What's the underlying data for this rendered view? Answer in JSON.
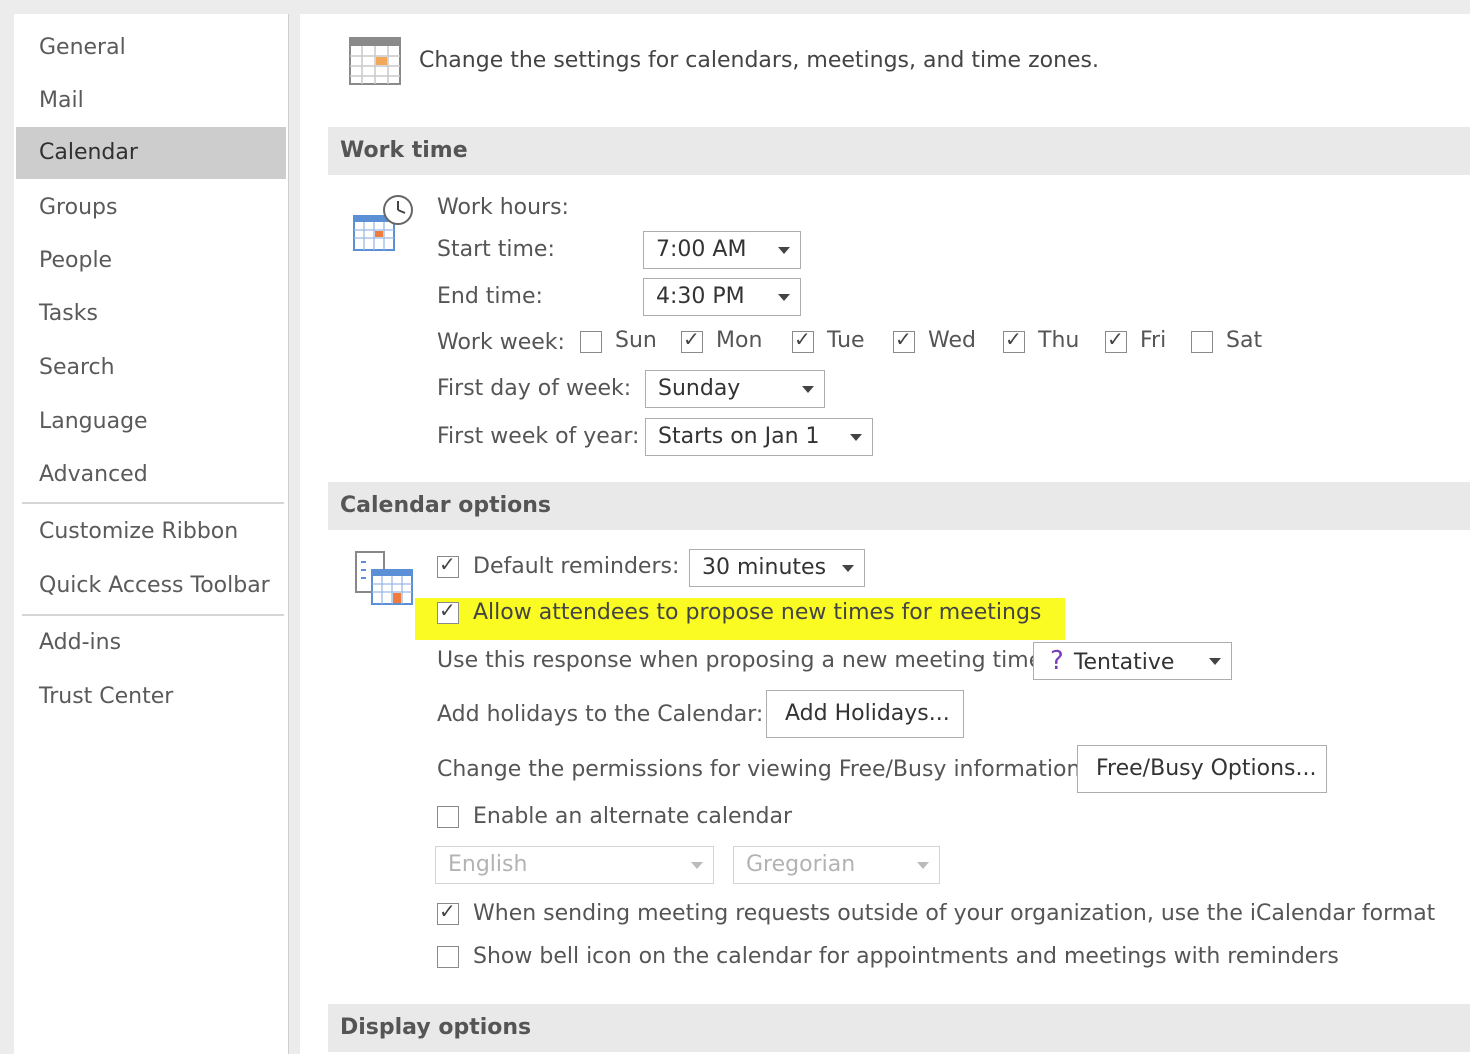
{
  "sidebar": {
    "items": [
      {
        "label": "General"
      },
      {
        "label": "Mail"
      },
      {
        "label": "Calendar"
      },
      {
        "label": "Groups"
      },
      {
        "label": "People"
      },
      {
        "label": "Tasks"
      },
      {
        "label": "Search"
      },
      {
        "label": "Language"
      },
      {
        "label": "Advanced"
      },
      {
        "label": "Customize Ribbon"
      },
      {
        "label": "Quick Access Toolbar"
      },
      {
        "label": "Add-ins"
      },
      {
        "label": "Trust Center"
      }
    ],
    "selected": "Calendar"
  },
  "header": {
    "description": "Change the settings for calendars, meetings, and time zones."
  },
  "work_time": {
    "title": "Work time",
    "work_hours_label": "Work hours:",
    "start_time_label": "Start time:",
    "start_time_value": "7:00 AM",
    "end_time_label": "End time:",
    "end_time_value": "4:30 PM",
    "work_week_label": "Work week:",
    "days": [
      {
        "label": "Sun",
        "checked": false
      },
      {
        "label": "Mon",
        "checked": true
      },
      {
        "label": "Tue",
        "checked": true
      },
      {
        "label": "Wed",
        "checked": true
      },
      {
        "label": "Thu",
        "checked": true
      },
      {
        "label": "Fri",
        "checked": true
      },
      {
        "label": "Sat",
        "checked": false
      }
    ],
    "first_day_label": "First day of week:",
    "first_day_value": "Sunday",
    "first_week_label": "First week of year:",
    "first_week_value": "Starts on Jan 1"
  },
  "calendar_options": {
    "title": "Calendar options",
    "default_reminders_label": "Default reminders:",
    "default_reminders_checked": true,
    "default_reminders_value": "30 minutes",
    "allow_propose_label": "Allow attendees to propose new times for meetings",
    "allow_propose_checked": true,
    "response_label": "Use this response when proposing a new meeting time:",
    "response_value": "Tentative",
    "response_glyph": "?",
    "holidays_label": "Add holidays to the Calendar:",
    "holidays_button": "Add Holidays...",
    "permissions_label": "Change the permissions for viewing Free/Busy information:",
    "freebusy_button": "Free/Busy Options...",
    "alternate_label": "Enable an alternate calendar",
    "alternate_checked": false,
    "alt_language_value": "English",
    "alt_calendar_value": "Gregorian",
    "icalendar_label": "When sending meeting requests outside of your organization, use the iCalendar format",
    "icalendar_checked": true,
    "bell_label": "Show bell icon on the calendar for appointments and meetings with reminders",
    "bell_checked": false
  },
  "display_options": {
    "title": "Display options"
  },
  "colors": {
    "selected_bg": "#cdcdcd",
    "highlight": "#fbfb24",
    "section_bg": "#e9e9e9",
    "tentative": "#7a3db8"
  },
  "icons": [
    "calendar-settings-icon",
    "work-hours-clock-icon",
    "calendar-options-icon",
    "tentative-question-icon"
  ]
}
